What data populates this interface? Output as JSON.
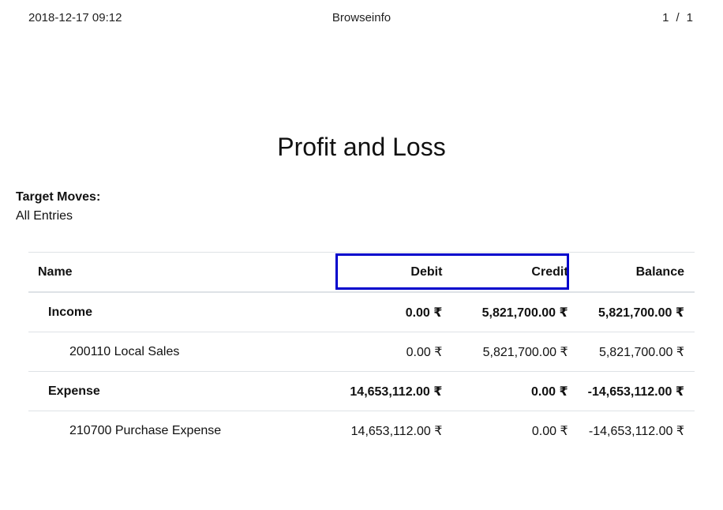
{
  "header": {
    "datetime": "2018-12-17 09:12",
    "site": "Browseinfo",
    "page_current": "1",
    "page_sep": "/",
    "page_total": "1"
  },
  "report": {
    "title": "Profit and Loss",
    "target_moves_label": "Target Moves:",
    "target_moves_value": "All Entries"
  },
  "table": {
    "columns": [
      "Name",
      "Debit",
      "Credit",
      "Balance"
    ],
    "rows": [
      {
        "name": "Income",
        "debit": "0.00 ₹",
        "credit": "5,821,700.00 ₹",
        "balance": "5,821,700.00 ₹"
      },
      {
        "name": "200110 Local Sales",
        "debit": "0.00 ₹",
        "credit": "5,821,700.00 ₹",
        "balance": "5,821,700.00 ₹"
      },
      {
        "name": "Expense",
        "debit": "14,653,112.00 ₹",
        "credit": "0.00 ₹",
        "balance": "-14,653,112.00 ₹"
      },
      {
        "name": "210700 Purchase Expense",
        "debit": "14,653,112.00 ₹",
        "credit": "0.00 ₹",
        "balance": "-14,653,112.00 ₹"
      }
    ]
  },
  "highlight_color": "#0000cc"
}
